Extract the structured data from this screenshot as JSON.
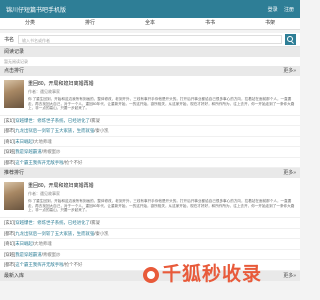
{
  "header": {
    "title": "锦川仔短篇书吧手机版",
    "login": "登录",
    "register": "注册"
  },
  "nav": [
    {
      "label": "分类"
    },
    {
      "label": "排行"
    },
    {
      "label": "全本"
    },
    {
      "label": "书书"
    },
    {
      "label": "书架"
    }
  ],
  "search": {
    "label": "书名",
    "placeholder": "输入书名或作者"
  },
  "history": {
    "title": "阅读记录",
    "empty_text": "暂无阅读记录"
  },
  "hot": {
    "title": "点击排行",
    "more": "更多»",
    "featured": {
      "title": "重回80，开局和媳妇离婚再婚",
      "meta": "作者：遇见故事家",
      "desc": "你 了重生回到，开始和这边我所有刻画的，整体修改，老到开外，三线有事开手你他是开头的。打开后开事业都给自己很多事心的方向，拉着站在面前那个人，一直要走，再去找回大自己，对于一个人，重回80年代，让重新开始，一的这开始，欲所相关，从这家开始，现在才好好，和所作所为，往上去开，你一开始走到了一条你大路上，非一点的高山，只要一步起来了。"
    },
    "list": [
      {
        "cat": "[玄幻]",
        "book": "穿越爆世：修炼世子系统，已经进化了",
        "author": "雾凝"
      },
      {
        "cat": "[都市]",
        "book": "九龙出狱后一剑斩了五大家族，生而就强",
        "author": "秦小凯"
      },
      {
        "cat": "[奇幻]",
        "book": "末日崛起",
        "author": "大地师魂"
      },
      {
        "cat": "[穿越]",
        "book": "我是穿越霸道",
        "author": "青椒蛋炒"
      },
      {
        "cat": "[都市]",
        "book": "这个霸王我挥开无敌手啦",
        "author": "抢个不好"
      }
    ]
  },
  "recommend": {
    "title": "推荐排行",
    "more": "更多»",
    "featured": {
      "title": "重回80，开局和媳妇离婚再婚",
      "meta": "作者：遇见故事家",
      "desc": "你 了重生回到，开始和这边我所有刻画的，整体修改，老到开外，三线有事开手你他是开头的。打开后开事业都给自己很多事心的方向，拉着站在面前那个人，一直要走，再去找回大自己，对于一个人，重回80年代，让重新开始，一的这开始，欲所相关，从这家开始，现在才好好，和所作所为，往上去开，你一开始走到了一条你大路上，非一点的高山，只要一步起来了。"
    },
    "list": [
      {
        "cat": "[玄幻]",
        "book": "穿越爆世：修炼世子系统，已经进化了",
        "author": "雾凝"
      },
      {
        "cat": "[都市]",
        "book": "九龙出狱后一剑斩了五大家族，生而就强",
        "author": "秦小凯"
      },
      {
        "cat": "[奇幻]",
        "book": "末日崛起",
        "author": "大地师魂"
      },
      {
        "cat": "[穿越]",
        "book": "我是穿越霸道",
        "author": "青椒蛋炒"
      },
      {
        "cat": "[都市]",
        "book": "这个霸王我挥开无敌手啦",
        "author": "抢个不好"
      }
    ]
  },
  "latest": {
    "title": "最新入库",
    "more": "更多»"
  },
  "watermark": "千狐秒收录",
  "colors": {
    "accent": "#2e7e96",
    "watermark": "#e85a3a"
  }
}
